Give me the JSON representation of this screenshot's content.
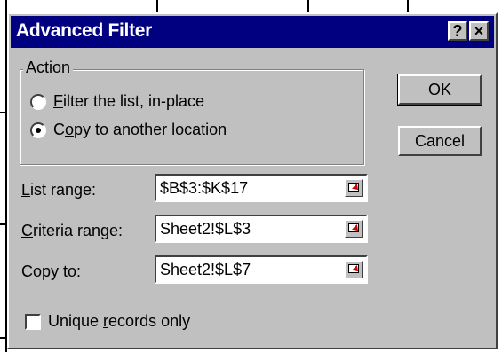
{
  "window": {
    "title": "Advanced Filter",
    "help_button": "?",
    "close_button": "×"
  },
  "action_group": {
    "label": "Action",
    "options": [
      {
        "prefix": "",
        "mnemonic": "F",
        "rest": "ilter the list, in-place",
        "selected": false
      },
      {
        "prefix": "C",
        "mnemonic": "o",
        "rest": "py to another location",
        "selected": true
      }
    ]
  },
  "buttons": {
    "ok": "OK",
    "cancel": "Cancel"
  },
  "fields": [
    {
      "label_prefix": "",
      "label_mnemonic": "L",
      "label_rest": "ist range:",
      "value": "$B$3:$K$17"
    },
    {
      "label_prefix": "",
      "label_mnemonic": "C",
      "label_rest": "riteria range:",
      "value": "Sheet2!$L$3"
    },
    {
      "label_prefix": "Copy ",
      "label_mnemonic": "t",
      "label_rest": "o:",
      "value": "Sheet2!$L$7"
    }
  ],
  "unique_records": {
    "label_prefix": "Unique ",
    "label_mnemonic": "r",
    "label_rest": "ecords only",
    "checked": false
  },
  "colors": {
    "titlebar": "#000080",
    "dialog_face": "#c0c0c0",
    "collapse_arrow": "#d00000"
  },
  "icons": {
    "collapse_dialog": "collapse-dialog-icon"
  }
}
